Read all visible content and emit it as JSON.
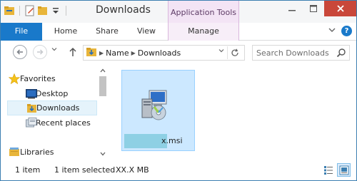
{
  "window": {
    "title": "Downloads",
    "context_header": "Application Tools"
  },
  "ribbon": {
    "tabs": [
      {
        "label": "File"
      },
      {
        "label": "Home"
      },
      {
        "label": "Share"
      },
      {
        "label": "View"
      },
      {
        "label": "Manage"
      }
    ]
  },
  "address": {
    "crumbs": [
      "Name",
      "Downloads"
    ]
  },
  "search": {
    "placeholder": "Search Downloads"
  },
  "nav": {
    "items": [
      {
        "label": "Favorites",
        "icon": "star-icon"
      },
      {
        "label": "Desktop",
        "icon": "desktop-icon"
      },
      {
        "label": "Downloads",
        "icon": "downloads-folder-icon"
      },
      {
        "label": "Recent places",
        "icon": "recent-places-icon"
      },
      {
        "label": "Libraries",
        "icon": "libraries-icon"
      }
    ]
  },
  "content": {
    "file_name_suffix": "x.msi",
    "file_icon": "msi-installer-icon"
  },
  "status": {
    "count": "1 item",
    "selected": "1 item selected",
    "size": "XX.X MB"
  },
  "colors": {
    "file_tab": "#1979ca",
    "context_tab": "#f3e4f5",
    "selection": "#cce8ff",
    "close_button": "#c9473a"
  }
}
